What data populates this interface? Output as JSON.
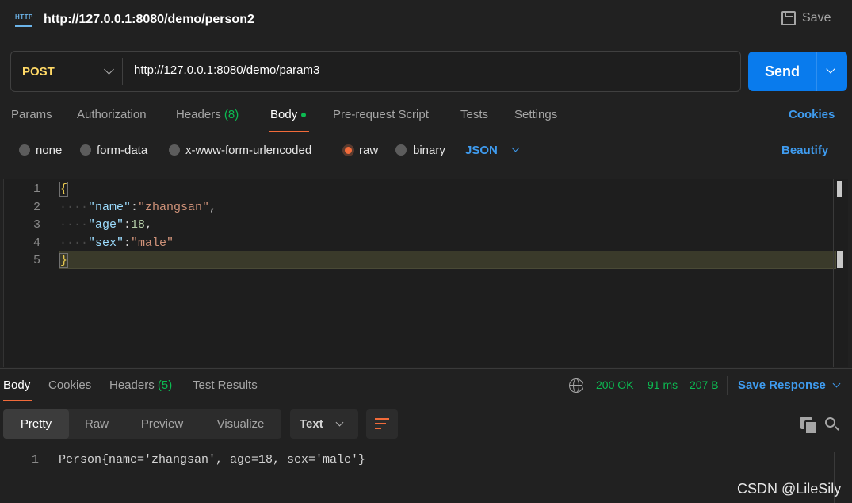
{
  "tab": {
    "title": "http://127.0.0.1:8080/demo/person2",
    "save_label": "Save",
    "icon": "http-icon"
  },
  "request": {
    "method": "POST",
    "url": "http://127.0.0.1:8080/demo/param3",
    "send_label": "Send",
    "tabs": [
      {
        "label": "Params"
      },
      {
        "label": "Authorization"
      },
      {
        "label": "Headers",
        "count": "(8)"
      },
      {
        "label": "Body"
      },
      {
        "label": "Pre-request Script"
      },
      {
        "label": "Tests"
      },
      {
        "label": "Settings"
      }
    ],
    "cookies_label": "Cookies",
    "body_types": [
      "none",
      "form-data",
      "x-www-form-urlencoded",
      "raw",
      "binary"
    ],
    "selected_body_type": "raw",
    "format": "JSON",
    "beautify_label": "Beautify"
  },
  "editor": {
    "line_numbers": [
      "1",
      "2",
      "3",
      "4",
      "5"
    ],
    "lines": {
      "l1": "{",
      "l2_key": "\"name\"",
      "l2_colon": ":",
      "l2_val": "\"zhangsan\"",
      "l2_comma": ",",
      "l3_key": "\"age\"",
      "l3_colon": ":",
      "l3_val": "18",
      "l3_comma": ",",
      "l4_key": "\"sex\"",
      "l4_colon": ":",
      "l4_val": "\"male\"",
      "l5": "}",
      "indent": "····"
    }
  },
  "response": {
    "tabs": [
      {
        "label": "Body"
      },
      {
        "label": "Cookies"
      },
      {
        "label": "Headers",
        "count": "(5)"
      },
      {
        "label": "Test Results"
      }
    ],
    "status": "200 OK",
    "time": "91 ms",
    "size": "207 B",
    "save_response_label": "Save Response",
    "view_modes": [
      "Pretty",
      "Raw",
      "Preview",
      "Visualize"
    ],
    "active_view": "Pretty",
    "type": "Text",
    "body_line_number": "1",
    "body_line": "Person{name='zhangsan', age=18, sex='male'}"
  },
  "watermark": "CSDN @LileSily",
  "colors": {
    "accent": "#f26b3a",
    "link": "#3f9cf0",
    "send": "#097bed",
    "success": "#0cbb52",
    "method": "#ffd966"
  }
}
